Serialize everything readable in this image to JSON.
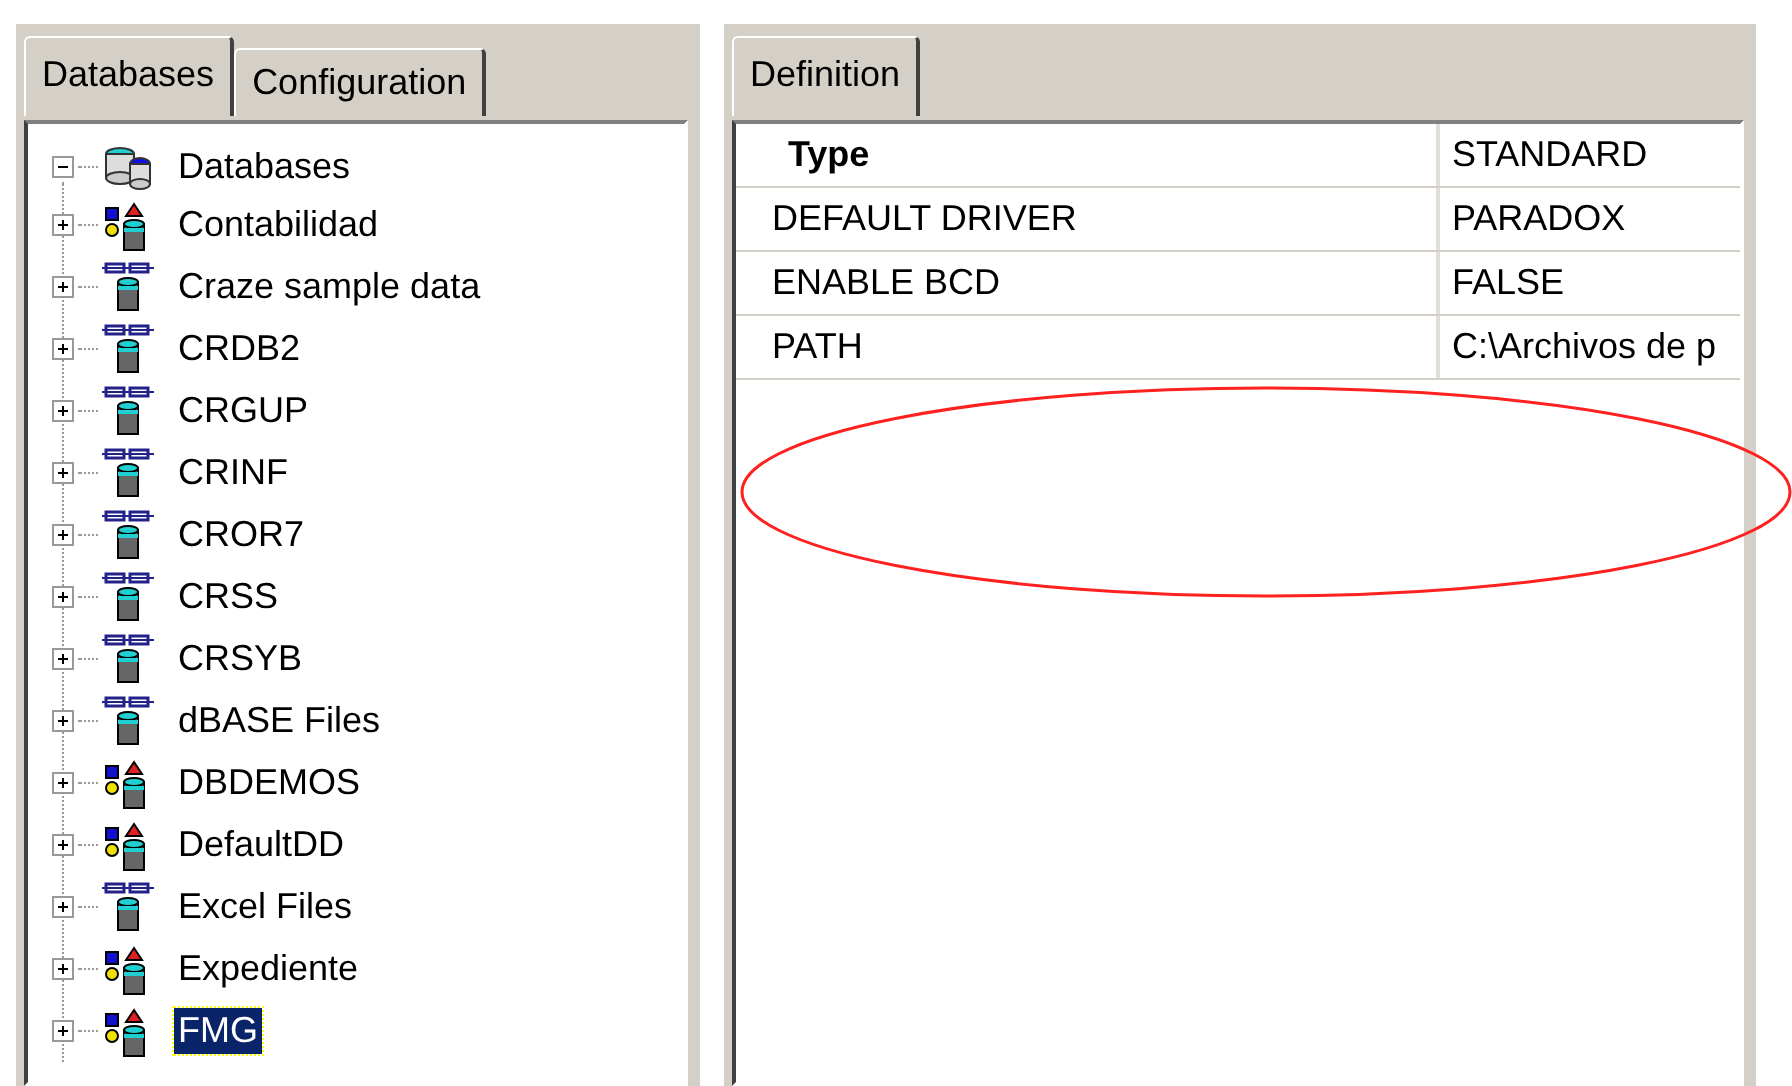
{
  "left_tabs": [
    {
      "label": "Databases",
      "selected": true
    },
    {
      "label": "Configuration",
      "selected": false
    }
  ],
  "tree": {
    "label": "Databases",
    "expanded": true,
    "children": [
      {
        "label": "Contabilidad",
        "kind": "standard",
        "selected": false
      },
      {
        "label": "Craze sample data",
        "kind": "alias",
        "selected": false
      },
      {
        "label": "CRDB2",
        "kind": "alias",
        "selected": false
      },
      {
        "label": "CRGUP",
        "kind": "alias",
        "selected": false
      },
      {
        "label": "CRINF",
        "kind": "alias",
        "selected": false
      },
      {
        "label": "CROR7",
        "kind": "alias",
        "selected": false
      },
      {
        "label": "CRSS",
        "kind": "alias",
        "selected": false
      },
      {
        "label": "CRSYB",
        "kind": "alias",
        "selected": false
      },
      {
        "label": "dBASE Files",
        "kind": "alias",
        "selected": false
      },
      {
        "label": "DBDEMOS",
        "kind": "standard",
        "selected": false
      },
      {
        "label": "DefaultDD",
        "kind": "standard",
        "selected": false
      },
      {
        "label": "Excel Files",
        "kind": "alias",
        "selected": false
      },
      {
        "label": "Expediente",
        "kind": "standard",
        "selected": false
      },
      {
        "label": "FMG",
        "kind": "standard",
        "selected": true
      }
    ]
  },
  "right_tabs": [
    {
      "label": "Definition",
      "selected": true
    }
  ],
  "definition": [
    {
      "name": "Type",
      "value": "STANDARD",
      "header": true
    },
    {
      "name": "DEFAULT DRIVER",
      "value": "PARADOX",
      "header": false
    },
    {
      "name": "ENABLE BCD",
      "value": "FALSE",
      "header": false
    },
    {
      "name": "PATH",
      "value": "C:\\Archivos de p",
      "header": false
    }
  ]
}
